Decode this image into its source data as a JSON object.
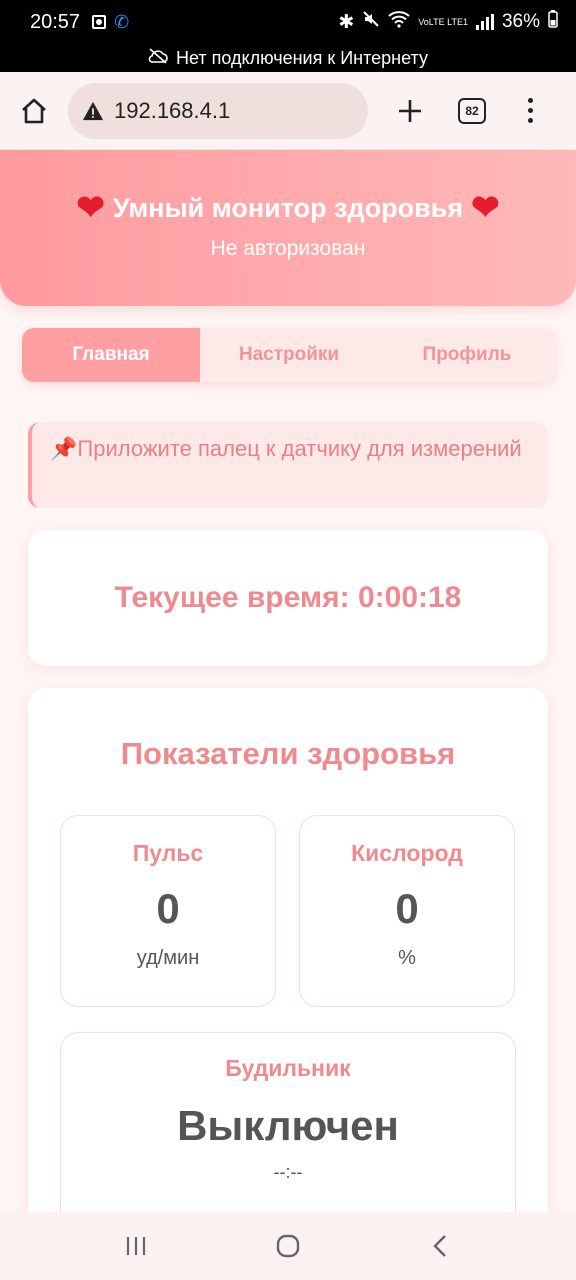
{
  "status_bar": {
    "time": "20:57",
    "battery": "36%",
    "network": "VoLTE LTE1"
  },
  "offline_banner": "Нет подключения к Интернету",
  "browser": {
    "url": "192.168.4.1",
    "tab_count": "82"
  },
  "hero": {
    "title": "Умный монитор здоровья",
    "subtitle": "Не авторизован"
  },
  "tabs": [
    {
      "label": "Главная",
      "active": true
    },
    {
      "label": "Настройки",
      "active": false
    },
    {
      "label": "Профиль",
      "active": false
    }
  ],
  "notice": {
    "icon": "📌",
    "text": "Приложите палец к датчику для измерений"
  },
  "clock": {
    "label": "Текущее время:",
    "value": "0:00:18"
  },
  "health": {
    "title": "Показатели здоровья",
    "pulse": {
      "label": "Пульс",
      "value": "0",
      "unit": "уд/мин"
    },
    "oxygen": {
      "label": "Кислород",
      "value": "0",
      "unit": "%"
    },
    "alarm": {
      "label": "Будильник",
      "status": "Выключен",
      "time": "--:--"
    }
  },
  "colors": {
    "accent": "#ff9ea3",
    "accent_text": "#ef8a90",
    "heart": "#e31d2b"
  }
}
